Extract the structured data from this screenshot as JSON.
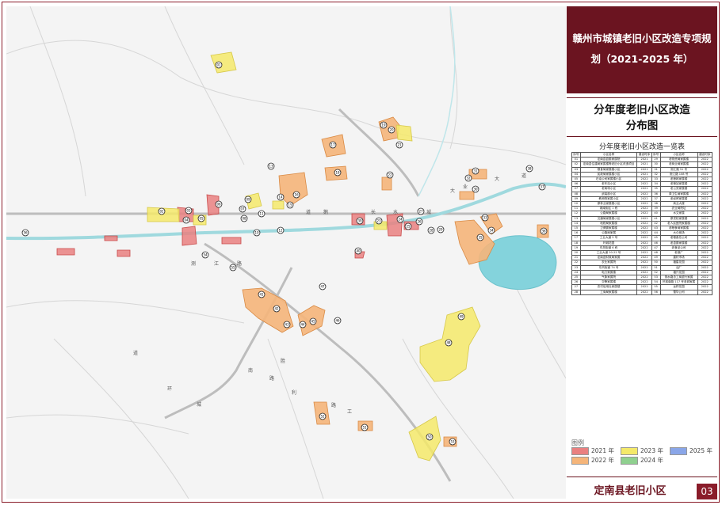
{
  "header": {
    "title_line1": "赣州市城镇老旧小区改造专项规",
    "title_line2": "划（2021-2025 年）"
  },
  "map_title": {
    "line1": "分年度老旧小区改造",
    "line2": "分布图"
  },
  "table": {
    "caption": "分年度老旧小区改造一览表",
    "headers": [
      "序号",
      "小区名称",
      "建设时序",
      "序号",
      "小区名称",
      "建设时序"
    ],
    "rows": [
      [
        "01",
        "定南县县委家属院",
        "2021",
        "29",
        "老物资局家属楼",
        "2022"
      ],
      [
        "02",
        "定南县住建局家属楼等老旧小区改造项目",
        "2021",
        "30",
        "老商业局家属楼",
        "2022"
      ],
      [
        "03",
        "粮食局家属楼小区",
        "2021",
        "31",
        "测江路 51 号",
        "2022"
      ],
      [
        "04",
        "民政局家属楼小区",
        "2021",
        "32",
        "测江路 108 号",
        "2022"
      ],
      [
        "05",
        "石油公司家属楼小区",
        "2022",
        "33",
        "老粮政家属楼",
        "2022"
      ],
      [
        "06",
        "老车站小区",
        "2022",
        "34",
        "老粮站家属楼",
        "2022"
      ],
      [
        "07",
        "老商场小区",
        "2022",
        "35",
        "老公安家属楼",
        "2022"
      ],
      [
        "08",
        "武装部小区",
        "2022",
        "36",
        "原卫生局家属楼",
        "2022"
      ],
      [
        "09",
        "教师院家属小区",
        "2022",
        "37",
        "老经贸家属楼",
        "2022"
      ],
      [
        "10",
        "原林业家属楼小区",
        "2022",
        "38",
        "商业大楼",
        "2022"
      ],
      [
        "11",
        "城南街区 1 栋",
        "2022",
        "39",
        "农业局院址",
        "2022"
      ],
      [
        "12",
        "公路局家属楼",
        "2022",
        "40",
        "水文家属",
        "2022"
      ],
      [
        "13",
        "交通局家属楼小区",
        "2022",
        "41",
        "原党校家属楼",
        "2022"
      ],
      [
        "14",
        "地税局家属楼",
        "2022",
        "42",
        "老人民医院家属楼",
        "2022"
      ],
      [
        "15",
        "卫健委家属楼",
        "2022",
        "43",
        "老粮食局家属楼",
        "2022"
      ],
      [
        "16",
        "公路局家属",
        "2022",
        "44",
        "大众商场",
        "2022"
      ],
      [
        "17",
        "工业大道 5 号",
        "2022",
        "45",
        "老粮食总公司",
        "2022"
      ],
      [
        "18",
        "环城花园",
        "2022",
        "46",
        "老县委家属楼",
        "2022"
      ],
      [
        "19",
        "东风街道 6 栋",
        "2022",
        "47",
        "老食品公司",
        "2022"
      ],
      [
        "20",
        "工业大道 20-22 号",
        "2022",
        "48",
        "老钢厂",
        "2022"
      ],
      [
        "21",
        "定南县财政局家属",
        "2022",
        "49",
        "建材市场",
        "2022"
      ],
      [
        "22",
        "农业家属院",
        "2022",
        "50",
        "福星花园",
        "2022"
      ],
      [
        "23",
        "东风街道 74 号",
        "2022",
        "51",
        "油厂",
        "2022"
      ],
      [
        "24",
        "电力家属楼",
        "2022",
        "52",
        "福兴花园",
        "2022"
      ],
      [
        "25",
        "气象家属院",
        "2022",
        "53",
        "测水路总工商银行家属",
        "2022"
      ],
      [
        "26",
        "交警家属楼",
        "2022",
        "54",
        "环城南路 117 号老城家属",
        "2022"
      ],
      [
        "27",
        "农村信用社家属楼",
        "2022",
        "55",
        "龙祥花园",
        "2022"
      ],
      [
        "28",
        "工商局家属楼",
        "2022",
        "56",
        "雪华公司",
        "2022"
      ]
    ]
  },
  "legend": {
    "title": "图例",
    "items": [
      {
        "label": "2021 年",
        "color": "#e98080"
      },
      {
        "label": "2023 年",
        "color": "#f4e96a"
      },
      {
        "label": "2025 年",
        "color": "#8aa6e8"
      },
      {
        "label": "2022 年",
        "color": "#f5b57a"
      },
      {
        "label": "2024 年",
        "color": "#8fd08f"
      }
    ]
  },
  "footer": {
    "title": "定南县老旧小区",
    "page": "03"
  },
  "map": {
    "road_labels": [
      "测",
      "江",
      "路",
      "长",
      "水",
      "道",
      "鹅",
      "城",
      "大",
      "道",
      "环",
      "城",
      "南",
      "路",
      "胜",
      "利",
      "路",
      "工",
      "业",
      "大",
      "道"
    ],
    "markers": [
      "01",
      "02",
      "03",
      "04",
      "05",
      "06",
      "07",
      "08",
      "09",
      "10",
      "11",
      "12",
      "13",
      "14",
      "15",
      "16",
      "17",
      "18",
      "19",
      "20",
      "21",
      "22",
      "23",
      "24",
      "25",
      "26",
      "27",
      "28",
      "29",
      "30",
      "31",
      "32",
      "33",
      "34",
      "35",
      "36",
      "37",
      "38",
      "39",
      "40",
      "41",
      "42",
      "43",
      "44",
      "45",
      "46",
      "47",
      "48",
      "49",
      "50",
      "51",
      "52",
      "53",
      "54",
      "55",
      "56"
    ]
  }
}
